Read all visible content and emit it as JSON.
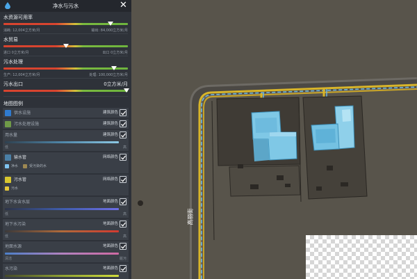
{
  "panel": {
    "title": "净水与污水",
    "metrics": [
      {
        "label": "水资源可用率",
        "left_sub": "消耗:  12,004立方米/月",
        "right_sub": "输出:  84,000立方米/月",
        "value_text": "",
        "level": 0.86
      },
      {
        "label": "水贸易",
        "left_sub": "进口 0立方米/月",
        "right_sub": "出口 0立方米/月",
        "value_text": "",
        "level": 0.5
      },
      {
        "label": "污水处理",
        "left_sub": "生产:  12,004立方米/月",
        "right_sub": "处理:  100,000立方米/月",
        "value_text": "",
        "level": 0.89
      },
      {
        "label": "污水出口",
        "left_sub": "",
        "right_sub": "",
        "value_text": "0立方米/月",
        "level": 0.99
      }
    ],
    "legend_title": "地图图例",
    "legend": [
      {
        "label": "供水设施",
        "toggle": "建筑颜色",
        "color": "#2f7bd0",
        "checked": true
      },
      {
        "label": "污水处理设施",
        "toggle": "建筑颜色",
        "color": "#6f9a48",
        "checked": true
      },
      {
        "label": "用水量",
        "toggle": "建筑颜色",
        "low": "低",
        "high": "高",
        "gradient": "linear-gradient(90deg,#2f4150,#4f86a8,#8cc8e4)",
        "checked": true
      },
      {
        "label": "输水管",
        "toggle": "网络颜色",
        "color": "#4a7fa6",
        "items": [
          "净水",
          "受污染的水"
        ],
        "item_colors": [
          "#7fc3f0",
          "#9c8752"
        ],
        "checked": true
      },
      {
        "label": "污水管",
        "toggle": "网络颜色",
        "color": "#d8c72f",
        "items": [
          "污水"
        ],
        "item_colors": [
          "#e5c83a"
        ],
        "checked": true
      },
      {
        "label": "地下水含水层",
        "toggle": "地面颜色",
        "low": "低",
        "high": "高",
        "gradient": "linear-gradient(90deg,#2d3448,#3f5cab,#6d6ee6)",
        "checked": true
      },
      {
        "label": "地下水污染",
        "toggle": "地面颜色",
        "low": "低",
        "high": "高",
        "gradient": "linear-gradient(90deg,#3c3a3a,#b06a3a,#d23a30)",
        "checked": true
      },
      {
        "label": "地面水源",
        "toggle": "地面颜色",
        "low": "清洁",
        "high": "脏污",
        "gradient": "linear-gradient(90deg,#4c7fc8,#b283c0,#cf6aa3)",
        "checked": true
      },
      {
        "label": "水污染",
        "toggle": "地面颜色",
        "low": "低",
        "high": "高",
        "gradient": "linear-gradient(90deg,#454a2a,#8fa032,#d0dc3c)",
        "checked": true
      }
    ]
  },
  "world": {
    "street_name": "高丽街"
  },
  "icons": {
    "drop": "water-drop-icon",
    "close": "close-icon",
    "check": "checkmark-icon"
  }
}
